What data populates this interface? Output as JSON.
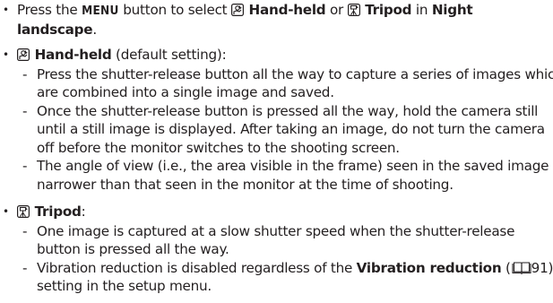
{
  "bullet_char": "•",
  "dash_char": "-",
  "bullets": [
    {
      "line1_pre": "Press the ",
      "menu_key": "MENU",
      "line1_mid": " button to select ",
      "handheld_label": "Hand-held",
      "or_word": " or ",
      "tripod_label": "Tripod",
      "in_word": " in ",
      "night_word": "Night",
      "landscape_word": "landscape",
      "period": "."
    },
    {
      "title": "Hand-held",
      "title_suffix": " (default setting):",
      "subitems": [
        {
          "lines": [
            "Press the shutter-release button all the way to capture a series of images which",
            "are combined into a single image and saved."
          ]
        },
        {
          "lines": [
            "Once the shutter-release button is pressed all the way, hold the camera still",
            "until a still image is displayed. After taking an image, do not turn the camera",
            "off before the monitor switches to the shooting screen."
          ]
        },
        {
          "lines": [
            "The angle of view (i.e., the area visible in the frame) seen in the saved image is",
            "narrower than that seen in the monitor at the time of shooting."
          ]
        }
      ]
    },
    {
      "title": "Tripod",
      "title_suffix": ":",
      "subitems": [
        {
          "lines": [
            "One image is captured at a slow shutter speed when the shutter-release",
            "button is pressed all the way."
          ]
        },
        {
          "line1_pre": "Vibration reduction is disabled regardless of the ",
          "line1_bold": "Vibration reduction",
          "line1_post_pre": " (",
          "page_ref": "91",
          "line1_post": ")",
          "line2": "setting in the setup menu."
        }
      ]
    }
  ],
  "icons": {
    "handheld": "handheld-night-icon",
    "tripod": "tripod-night-icon",
    "reference": "book-reference-icon"
  }
}
